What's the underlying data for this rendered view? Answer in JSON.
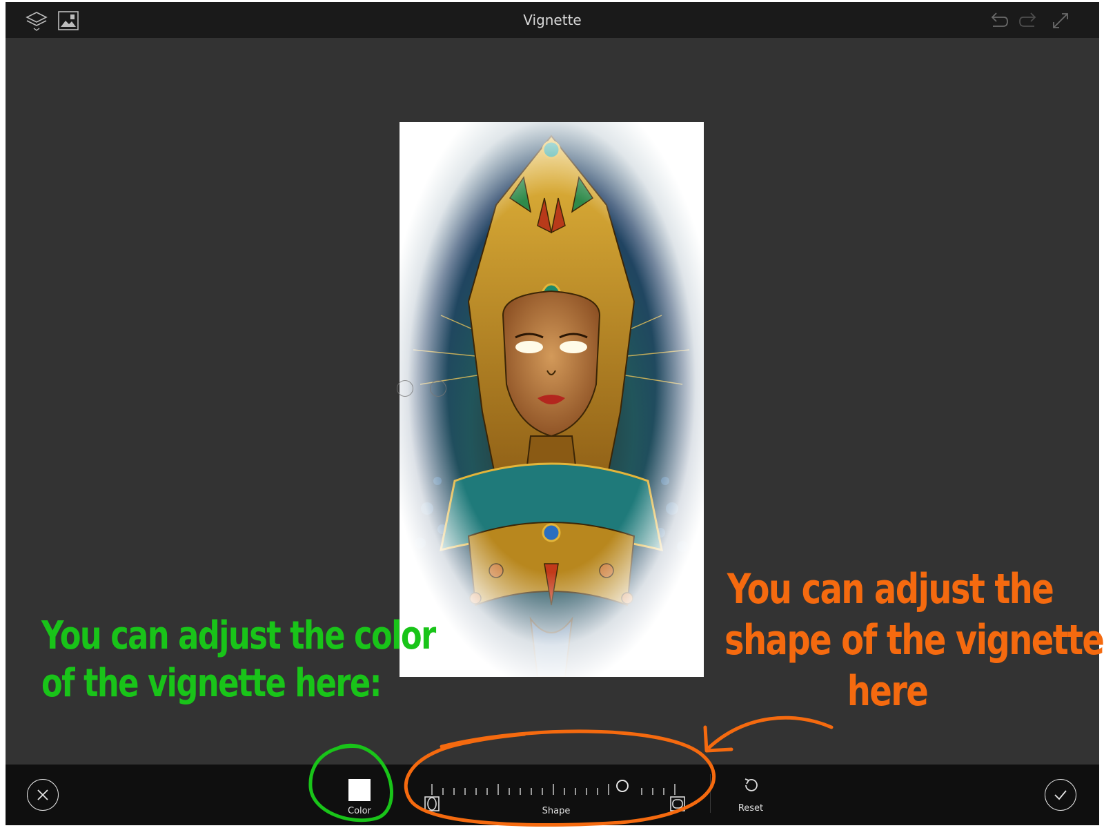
{
  "app": {
    "title": "Vignette"
  },
  "toolbar_top": {
    "left_icons": [
      "layers-icon",
      "image-icon"
    ],
    "right_icons": [
      "undo-icon",
      "redo-icon",
      "fullscreen-icon"
    ]
  },
  "bottom_bar": {
    "color_label": "Color",
    "shape_label": "Shape",
    "reset_label": "Reset",
    "color_value": "#ffffff",
    "shape_slider_value": 0.77
  },
  "annotations": {
    "color_note_line1": "You can adjust the color",
    "color_note_line2": "of the vignette here:",
    "shape_note_line1": "You can adjust the",
    "shape_note_line2": "shape of the vignette",
    "shape_note_line3": "here"
  },
  "colors": {
    "app_background": "#323232",
    "topbar": "#1a1a1a",
    "bottombar": "#0f0f0f",
    "annotation_green": "#19c419",
    "annotation_orange": "#f56a0f"
  }
}
